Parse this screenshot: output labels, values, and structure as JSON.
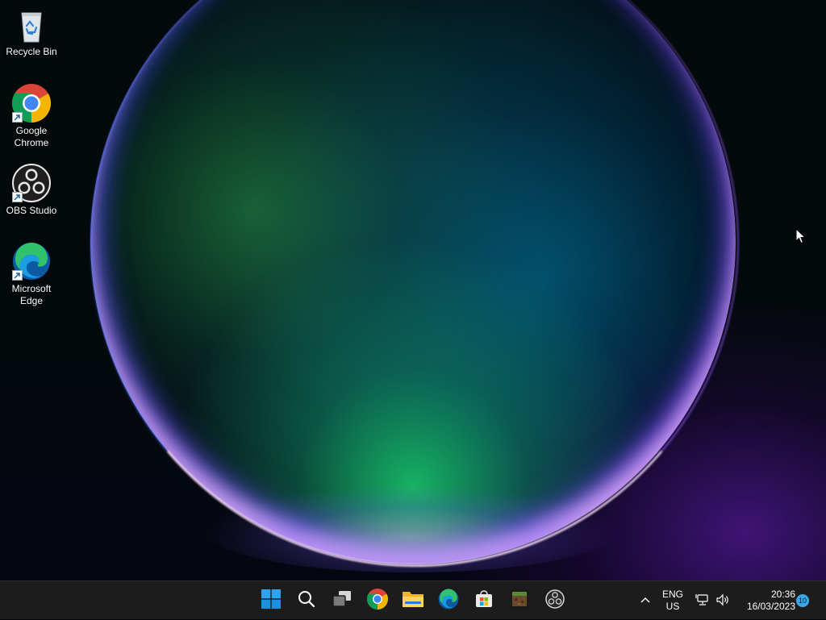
{
  "desktop": {
    "icons": [
      {
        "label": "Recycle Bin",
        "icon": "recycle-bin-icon"
      },
      {
        "label": "Google Chrome",
        "icon": "chrome-icon"
      },
      {
        "label": "OBS Studio",
        "icon": "obs-icon"
      },
      {
        "label": "Microsoft Edge",
        "icon": "edge-icon"
      }
    ]
  },
  "taskbar": {
    "apps": [
      {
        "icon": "windows-start-icon"
      },
      {
        "icon": "search-icon"
      },
      {
        "icon": "task-view-icon"
      },
      {
        "icon": "chrome-icon"
      },
      {
        "icon": "file-explorer-icon"
      },
      {
        "icon": "edge-icon"
      },
      {
        "icon": "microsoft-store-icon"
      },
      {
        "icon": "minecraft-icon"
      },
      {
        "icon": "obs-icon"
      }
    ],
    "tray": {
      "language_line1": "ENG",
      "language_line2": "US",
      "time": "20:36",
      "date": "16/03/2023",
      "notification_count": "10"
    }
  },
  "colors": {
    "taskbar_bg": "#1c1c1c",
    "windows_blue": "#0a8fe6",
    "notification_badge": "#3aa8e6"
  }
}
